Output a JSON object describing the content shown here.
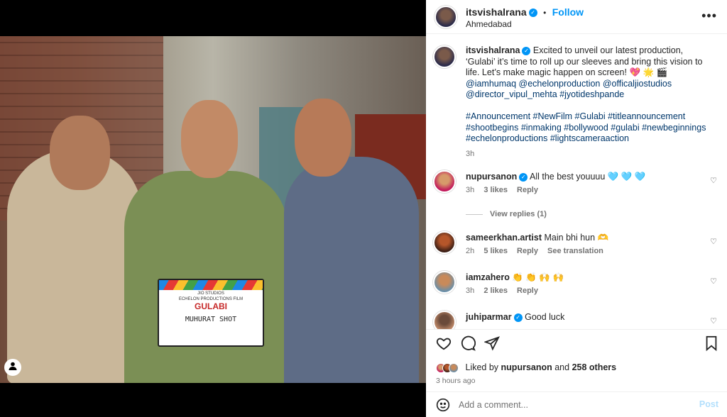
{
  "post_image": {
    "clapperboard": {
      "studio": "JIO STUDIOS",
      "presents": "ECHELON PRODUCTIONS FILM",
      "film": "GULABI",
      "shot": "MUHURAT SHOT"
    },
    "user_tag_icon": "user-tag-icon"
  },
  "header": {
    "username": "itsvishalrana",
    "dot": "•",
    "follow_label": "Follow",
    "location": "Ahmedabad",
    "more_icon": "more-options-icon"
  },
  "caption": {
    "username": "itsvishalrana",
    "text": "Excited to unveil our latest production, ‘Gulabi’ it’s time to roll up our sleeves and bring this vision to life. Let’s make magic happen on screen! 💖 🌟 🎬",
    "mentions": "@iamhumaq @echelonproduction @officaljiostudios @director_vipul_mehta #jyotideshpande",
    "hashtags": "#Announcement #NewFilm #Gulabi #titleannouncement #shootbegins #inmaking #bollywood #gulabi #newbeginnings #echelonproductions #lightscameraaction",
    "time": "3h"
  },
  "comments": [
    {
      "username": "nupursanon",
      "verified": true,
      "text": "All the best youuuu 🩵 🩵 🩵",
      "time": "3h",
      "likes": "3 likes",
      "reply": "Reply",
      "translate": ""
    },
    {
      "username": "sameerkhan.artist",
      "verified": false,
      "text": "Main bhi hun 🫶",
      "time": "2h",
      "likes": "5 likes",
      "reply": "Reply",
      "translate": "See translation"
    },
    {
      "username": "iamzahero",
      "verified": false,
      "text": "👏 👏 🙌 🙌",
      "time": "3h",
      "likes": "2 likes",
      "reply": "Reply",
      "translate": ""
    },
    {
      "username": "juhiparmar",
      "verified": true,
      "text": "Good luck",
      "time": "",
      "likes": "",
      "reply": "",
      "translate": ""
    }
  ],
  "view_replies": "View replies (1)",
  "actions": {
    "like_icon": "heart-icon",
    "comment_icon": "comment-icon",
    "share_icon": "send-icon",
    "save_icon": "bookmark-icon"
  },
  "likes": {
    "prefix": "Liked by",
    "user": "nupursanon",
    "middle": "and",
    "others": "258 others"
  },
  "posted_ago": "3 hours ago",
  "add_comment": {
    "placeholder": "Add a comment...",
    "post_label": "Post",
    "emoji_icon": "emoji-icon"
  },
  "colors": {
    "accent": "#0095f6",
    "link": "#00376b",
    "muted": "#737373"
  }
}
